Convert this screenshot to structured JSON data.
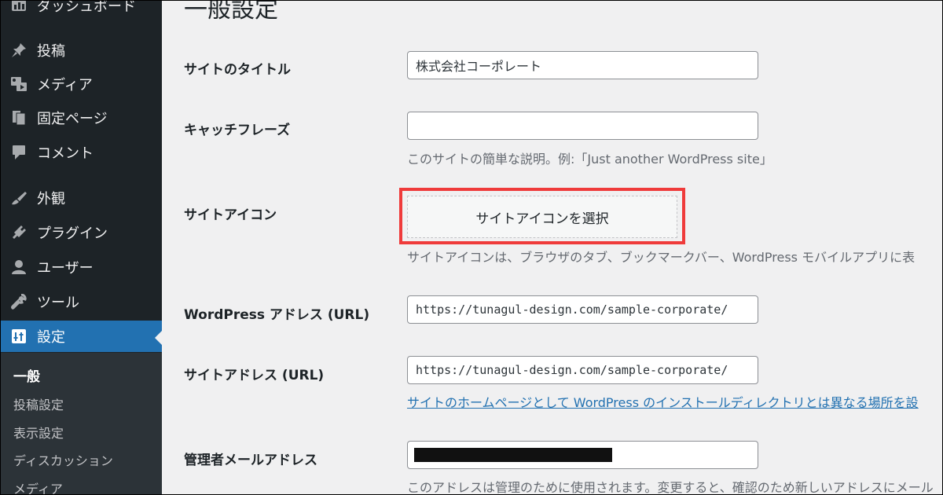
{
  "sidebar": {
    "items": [
      {
        "label": "ダッシュボード",
        "icon": "dashboard-icon"
      },
      {
        "label": "投稿",
        "icon": "pushpin-icon"
      },
      {
        "label": "メディア",
        "icon": "media-icon"
      },
      {
        "label": "固定ページ",
        "icon": "pages-icon"
      },
      {
        "label": "コメント",
        "icon": "comment-icon"
      },
      {
        "label": "外観",
        "icon": "appearance-icon"
      },
      {
        "label": "プラグイン",
        "icon": "plugin-icon"
      },
      {
        "label": "ユーザー",
        "icon": "user-icon"
      },
      {
        "label": "ツール",
        "icon": "wrench-icon"
      },
      {
        "label": "設定",
        "icon": "settings-icon"
      }
    ],
    "submenu": [
      "一般",
      "投稿設定",
      "表示設定",
      "ディスカッション",
      "メディア"
    ],
    "active_color": "#2271b1"
  },
  "main": {
    "title": "一般設定",
    "site_title": {
      "label": "サイトのタイトル",
      "value": "株式会社コーポレート"
    },
    "tagline": {
      "label": "キャッチフレーズ",
      "value": "",
      "description": "このサイトの簡単な説明。例:「Just another WordPress site」"
    },
    "site_icon": {
      "label": "サイトアイコン",
      "button": "サイトアイコンを選択",
      "description": "サイトアイコンは、ブラウザのタブ、ブックマークバー、WordPress モバイルアプリに表",
      "highlight_color": "#ef3b3b"
    },
    "wp_address": {
      "label": "WordPress アドレス (URL)",
      "value": "https://tunagul-design.com/sample-corporate/"
    },
    "site_address": {
      "label": "サイトアドレス (URL)",
      "value": "https://tunagul-design.com/sample-corporate/",
      "link": "サイトのホームページとして WordPress のインストールディレクトリとは異なる場所を設"
    },
    "admin_email": {
      "label": "管理者メールアドレス",
      "description": "このアドレスは管理のために使用されます。変更すると、確認のため新しいアドレスにメール"
    }
  }
}
